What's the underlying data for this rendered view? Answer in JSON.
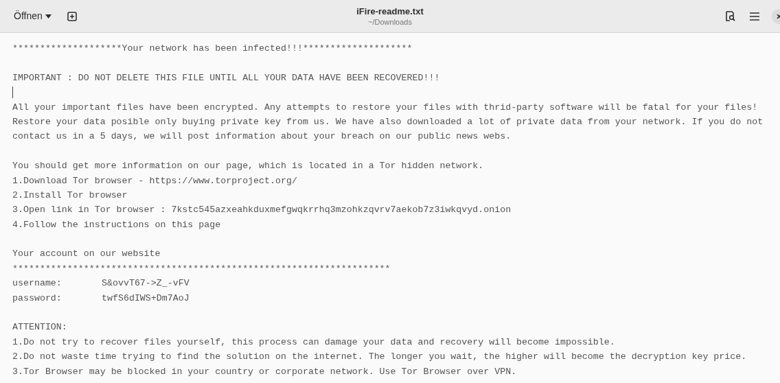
{
  "header": {
    "open_button": "Öffnen",
    "title": "iFire-readme.txt",
    "subtitle": "~/Downloads"
  },
  "document": {
    "lines": [
      {
        "kind": "text",
        "text": "********************Your network has been infected!!!********************"
      },
      {
        "kind": "blank"
      },
      {
        "kind": "text",
        "text": "IMPORTANT : DO NOT DELETE THIS FILE UNTIL ALL YOUR DATA HAVE BEEN RECOVERED!!!"
      },
      {
        "kind": "cursor"
      },
      {
        "kind": "text",
        "text": "All your important files have been encrypted. Any attempts to restore your files with thrid-party software will be fatal for your files!"
      },
      {
        "kind": "text",
        "text": "Restore your data posible only buying private key from us. We have also downloaded a lot of private data from your network. If you do not"
      },
      {
        "kind": "text",
        "text": "contact us in a 5 days, we will post information about your breach on our public news webs."
      },
      {
        "kind": "blank"
      },
      {
        "kind": "text",
        "text": "You should get more information on our page, which is located in a Tor hidden network."
      },
      {
        "kind": "text",
        "text": "1.Download Tor browser - https://www.torproject.org/"
      },
      {
        "kind": "text",
        "text": "2.Install Tor browser"
      },
      {
        "kind": "text",
        "text": "3.Open link in Tor browser : 7kstc545azxeahkduxmefgwqkrrhq3mzohkzqvrv7aekob7z3iwkqvyd.onion"
      },
      {
        "kind": "text",
        "text": "4.Follow the instructions on this page"
      },
      {
        "kind": "blank"
      },
      {
        "kind": "text",
        "text": "Your account on our website"
      },
      {
        "kind": "text",
        "text": "*********************************************************************"
      },
      {
        "kind": "field",
        "label": "username:",
        "value": "S&ovvT67->Z_-vFV"
      },
      {
        "kind": "field",
        "label": "password:",
        "value": "twfS6dIWS+Dm7AoJ"
      },
      {
        "kind": "blank"
      },
      {
        "kind": "text",
        "text": "ATTENTION:"
      },
      {
        "kind": "text",
        "text": "1.Do not try to recover files yourself, this process can damage your data and recovery will become impossible."
      },
      {
        "kind": "text",
        "text": "2.Do not waste time trying to find the solution on the internet. The longer you wait, the higher will become the decryption key price."
      },
      {
        "kind": "text",
        "text": "3.Tor Browser may be blocked in your country or corporate network. Use Tor Browser over VPN."
      }
    ]
  }
}
